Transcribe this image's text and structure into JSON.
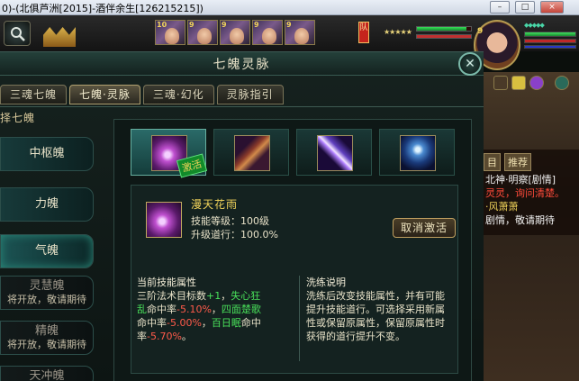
{
  "window": {
    "title": "0)-(北俱芦洲[2015]-酒伴余生[126215215])",
    "buttons": [
      "–",
      "□",
      "×"
    ]
  },
  "hud": {
    "party_levels": [
      "10",
      "9",
      "9",
      "9",
      "9",
      "9"
    ],
    "party_badge": "队",
    "self_level": "9"
  },
  "dialog": {
    "title": "七魄灵脉",
    "close_label": "✕",
    "tabs": [
      {
        "label": "三魂七魄",
        "active": false
      },
      {
        "label": "七魄·灵脉",
        "active": true
      },
      {
        "label": "三魂·幻化",
        "active": false
      },
      {
        "label": "灵脉指引",
        "active": false
      }
    ],
    "nav_header": "择七魄",
    "nav_items": [
      {
        "label": "中枢魄",
        "sub": "",
        "state": "normal"
      },
      {
        "label": "力魄",
        "sub": "",
        "state": "normal"
      },
      {
        "label": "气魄",
        "sub": "",
        "state": "active"
      },
      {
        "label": "灵慧魄",
        "sub": "将开放，敬请期待",
        "state": "locked"
      },
      {
        "label": "精魄",
        "sub": "将开放，敬请期待",
        "state": "locked"
      },
      {
        "label": "天冲魄",
        "sub": "",
        "state": "locked"
      }
    ],
    "skill_slots": [
      {
        "icon": "flower-rain-skill-icon",
        "active": true,
        "stamp": "激活"
      },
      {
        "icon": "cloak-warrior-skill-icon",
        "active": false
      },
      {
        "icon": "light-slash-skill-icon",
        "active": false
      },
      {
        "icon": "spirit-figure-skill-icon",
        "active": false
      }
    ],
    "detail": {
      "name": "漫天花雨",
      "level_label": "技能等级：",
      "level_value": "100级",
      "progress_label": "升级道行：",
      "progress_value": "100.0%",
      "cancel_button": "取消激活",
      "current_header": "当前技能属性",
      "attr_line1": "三阶法术目标数",
      "attr_bonus1": "+1",
      "attr_sep1": "，",
      "attr_name2": "失心狂",
      "attr_name2b": "乱",
      "attr_mid2": "命中率",
      "attr_val2": "-5.10%",
      "attr_sep2": "，",
      "attr_name3": "四面楚歌",
      "attr_mid3": "命中率",
      "attr_val3": "-5.00%",
      "attr_sep3": "，",
      "attr_name4": "百日眠",
      "attr_mid4": "命中",
      "attr_mid4b": "率",
      "attr_val4": "-5.70%",
      "attr_end": "。",
      "wash_header": "洗练说明",
      "wash_text": "洗练后改变技能属性，并有可能提升技能道行。可选择采用新属性或保留原属性，保留原属性时获得的道行提升不变。"
    }
  },
  "quest": {
    "tabs": [
      "目",
      "推荐"
    ],
    "lines": [
      {
        "text": "北神·明察[剧情]",
        "color": "white"
      },
      {
        "text": "灵灵，询问清楚。",
        "color": "mixed"
      },
      {
        "text": "·风萧萧",
        "color": "white"
      },
      {
        "text": "剧情，敬请期待",
        "color": "white"
      }
    ]
  },
  "colors": {
    "accent_gold": "#f0d35a",
    "positive_green": "#49e05a",
    "negative_red": "#ff5a4a",
    "panel_teal": "#1c5454"
  }
}
